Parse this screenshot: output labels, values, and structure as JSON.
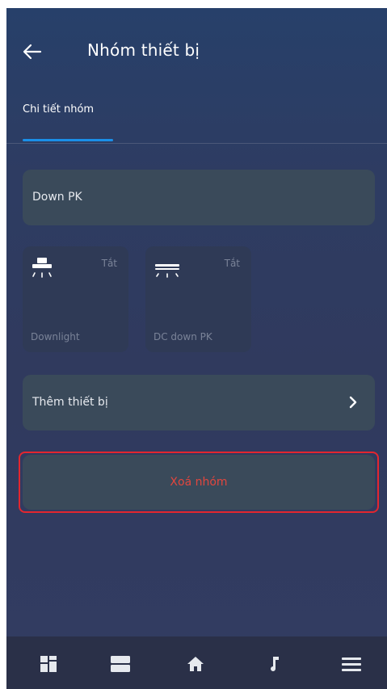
{
  "header": {
    "title": "Nhóm thiết bị"
  },
  "tabs": [
    {
      "label": "Chi tiết nhóm",
      "active": true
    }
  ],
  "group": {
    "name": "Down PK"
  },
  "devices": [
    {
      "name": "Downlight",
      "state": "Tắt",
      "icon": "downlight-icon"
    },
    {
      "name": "DC down PK",
      "state": "Tắt",
      "icon": "ceiling-light-icon"
    }
  ],
  "add_device": {
    "label": "Thêm thiết bị"
  },
  "delete_group": {
    "label": "Xoá nhóm"
  },
  "bottom_nav": [
    {
      "icon": "dashboard-icon"
    },
    {
      "icon": "rooms-icon"
    },
    {
      "icon": "home-icon"
    },
    {
      "icon": "music-icon"
    },
    {
      "icon": "menu-icon"
    }
  ],
  "colors": {
    "accent": "#1a8fe8",
    "danger": "#e2463e",
    "highlight": "#e3262f",
    "surface": "#3a4a5a",
    "background": "#303a5e"
  }
}
